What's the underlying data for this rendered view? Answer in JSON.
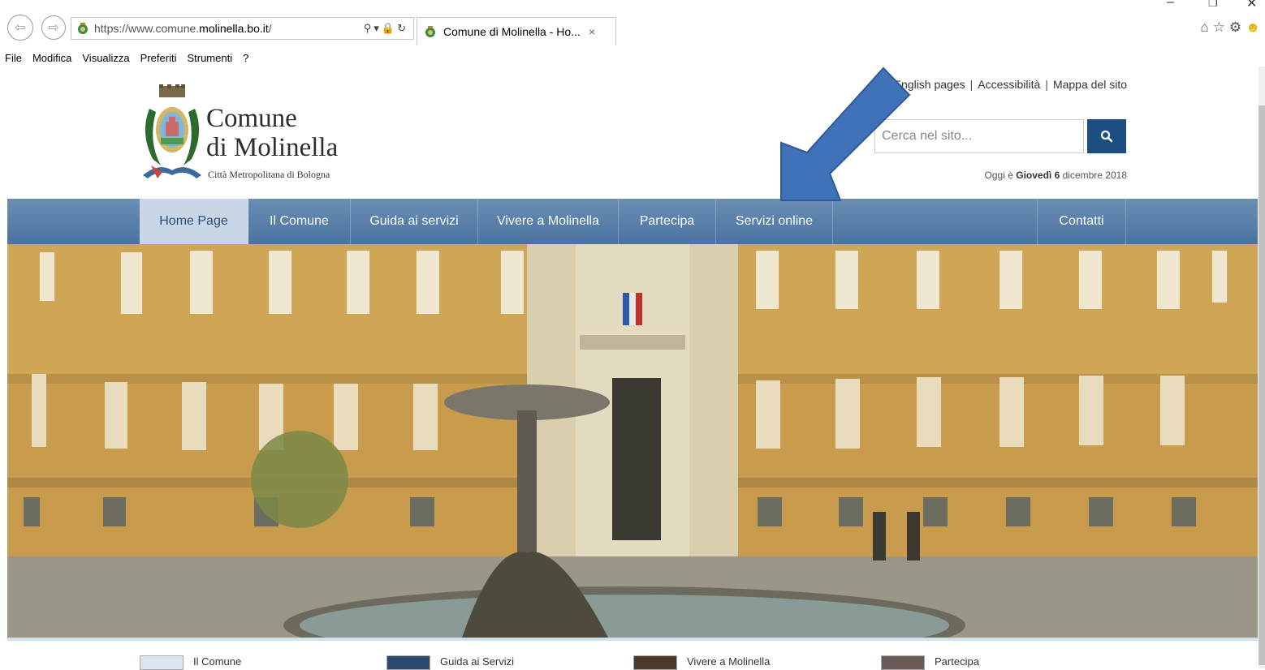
{
  "browser": {
    "url_prefix": "https://www.comune.",
    "url_domain": "molinella.bo.it",
    "url_suffix": "/",
    "tab_title": "Comune di Molinella - Ho...",
    "tab_close": "×",
    "menu": [
      "File",
      "Modifica",
      "Visualizza",
      "Preferiti",
      "Strumenti",
      "?"
    ]
  },
  "header": {
    "top_links": [
      "English pages",
      "Accessibilità",
      "Mappa del sito"
    ],
    "separator": "|",
    "title_line1": "Comune",
    "title_line2": "di Molinella",
    "subtitle": "Città Metropolitana di Bologna",
    "search_placeholder": "Cerca nel sito...",
    "date_prefix": "Oggi è ",
    "date_bold": "Giovedì 6",
    "date_suffix": " dicembre 2018"
  },
  "nav": {
    "items": [
      "Home Page",
      "Il Comune",
      "Guida ai servizi",
      "Vivere a Molinella",
      "Partecipa",
      "Servizi online"
    ],
    "contact": "Contatti"
  },
  "bottom": {
    "items": [
      "Il Comune",
      "Guida ai Servizi",
      "Vivere a Molinella",
      "Partecipa"
    ]
  },
  "colors": {
    "nav_bar": "#5a80ab",
    "search_button": "#1c4e82",
    "arrow": "#3f72b8"
  }
}
